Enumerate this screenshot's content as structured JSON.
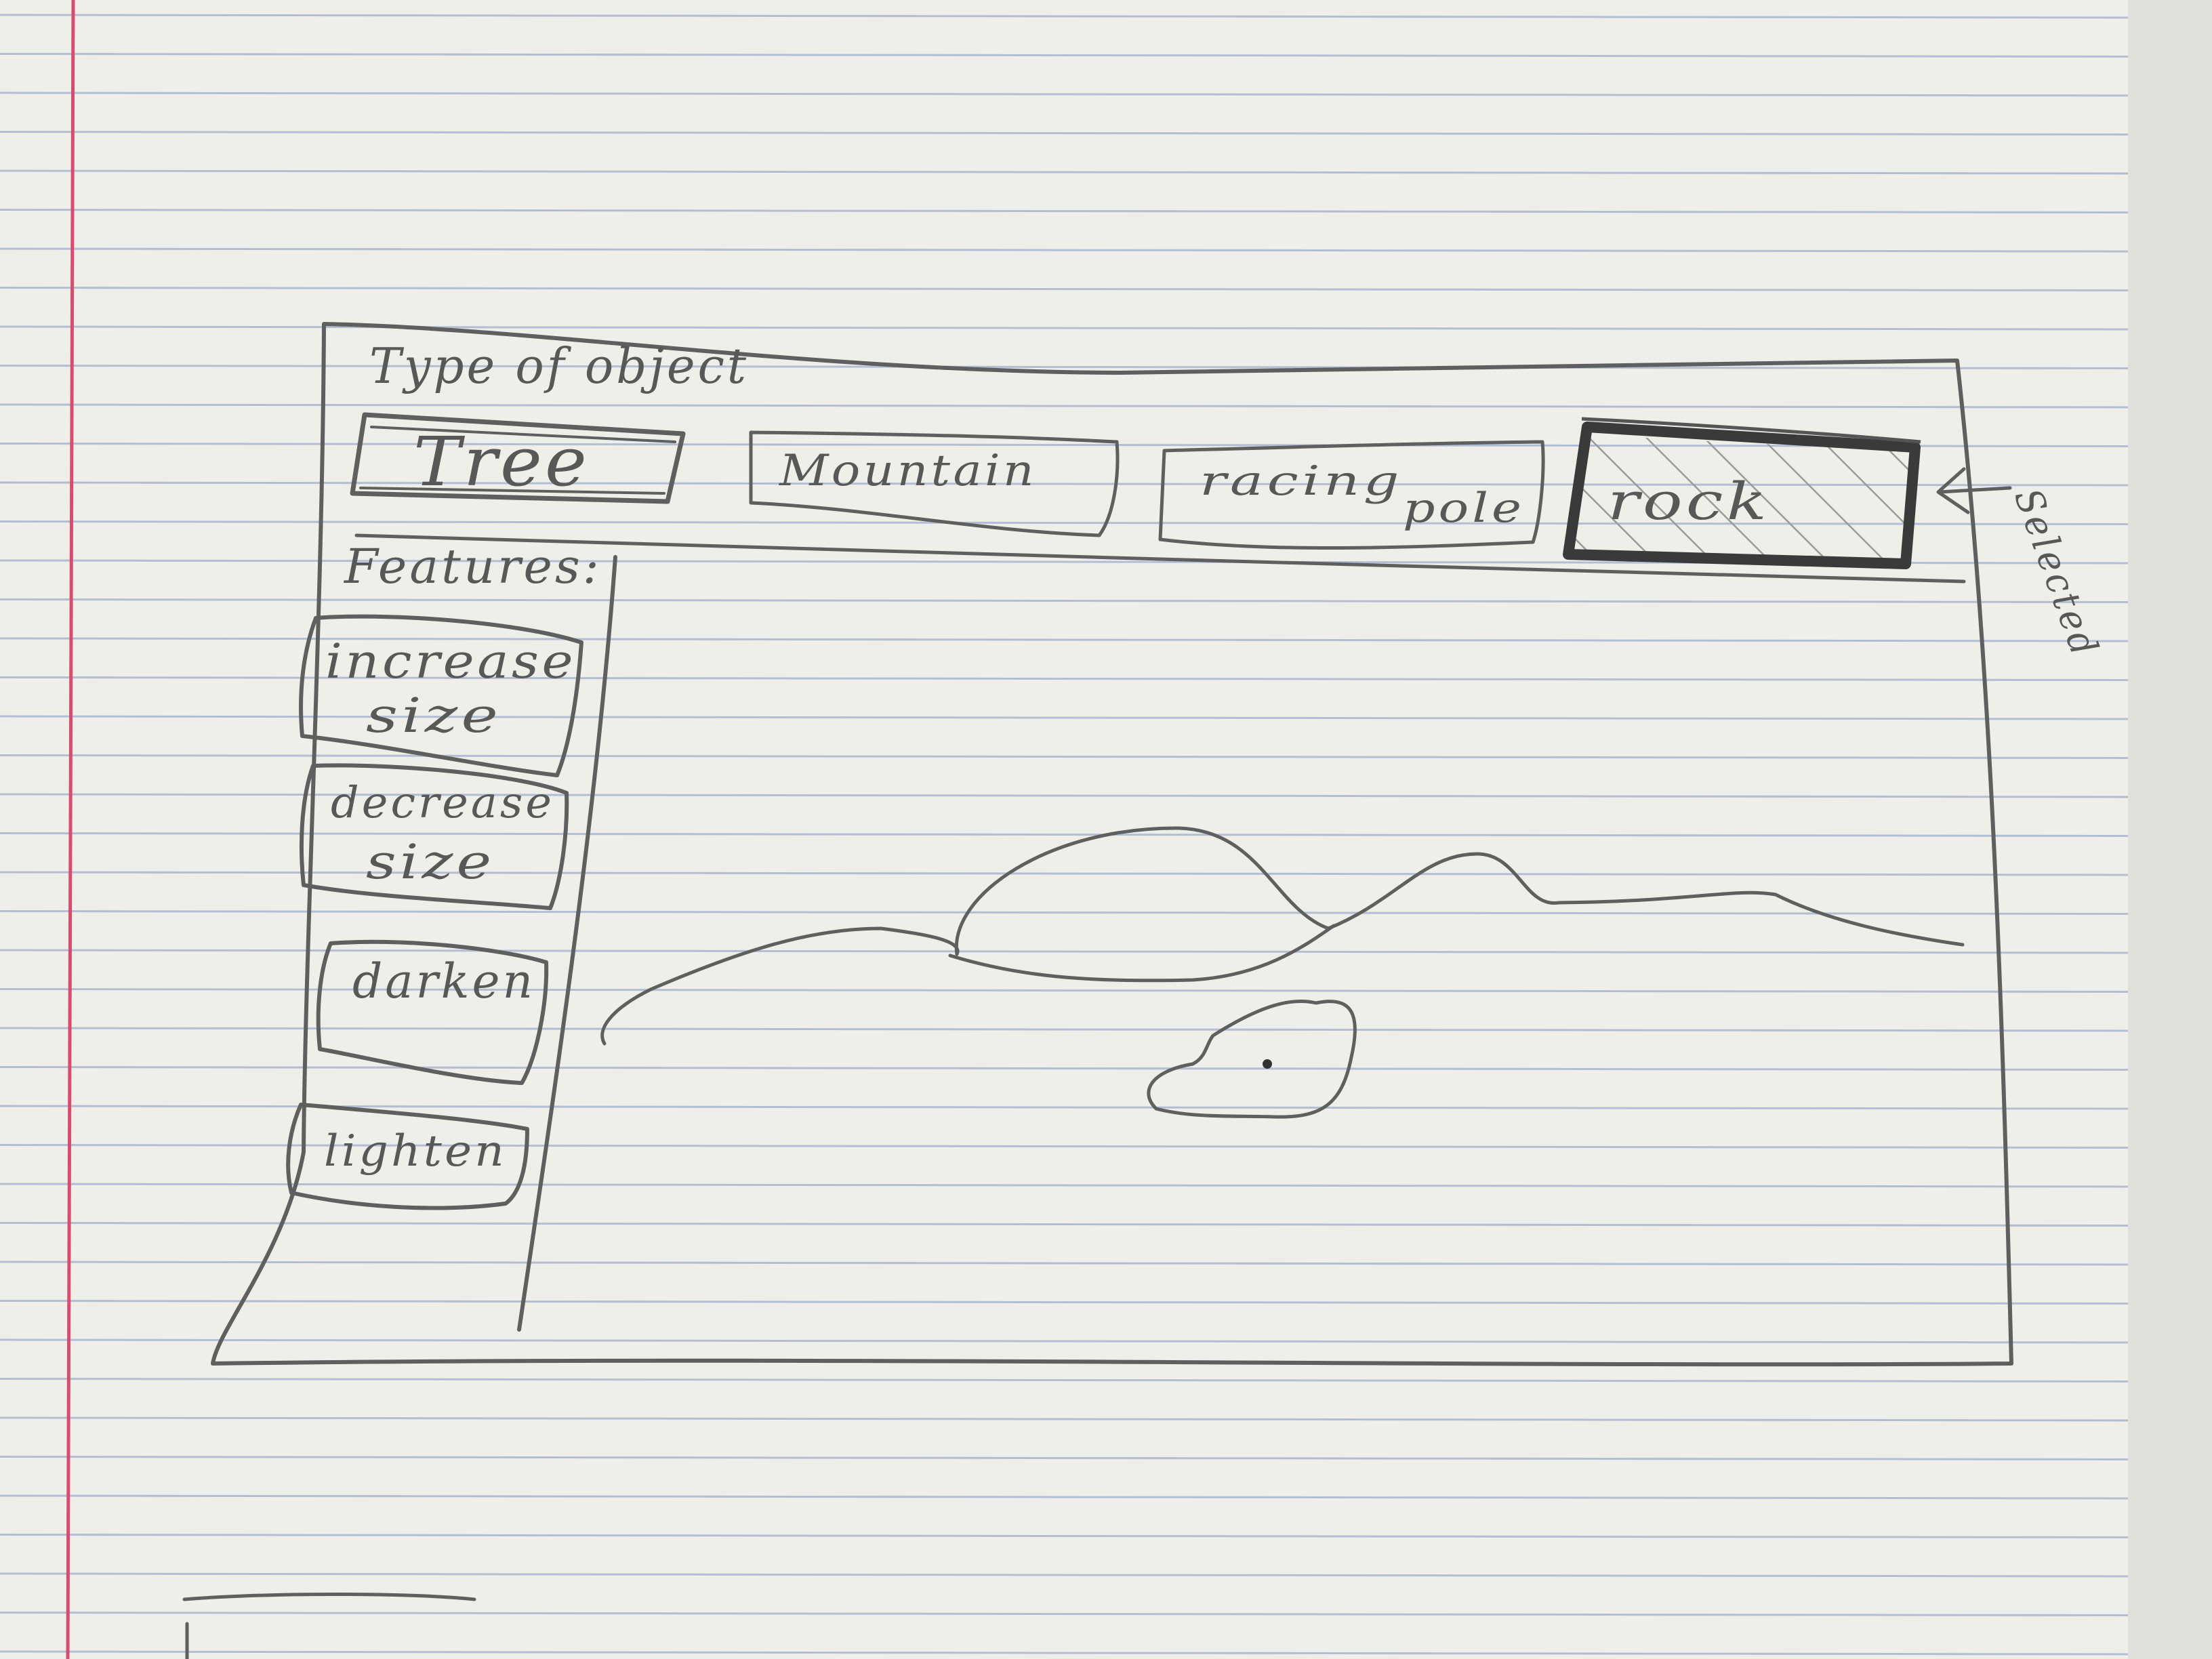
{
  "app": {
    "type_label": "Type of object",
    "features_label": "Features:"
  },
  "object_types": [
    {
      "label": "Tree"
    },
    {
      "label": "Mountain"
    },
    {
      "label_line1": "racing",
      "label_line2": "pole"
    },
    {
      "label": "rock"
    }
  ],
  "selected_object": "rock",
  "selected_annotation": "Selected",
  "features": [
    {
      "line1": "increase",
      "line2": "size"
    },
    {
      "line1": "decrease",
      "line2": "size"
    },
    {
      "line1": "darken"
    },
    {
      "line1": "lighten"
    }
  ],
  "colors": {
    "paper": "#efeee9",
    "rule_line": "#7f98c2",
    "margin_line": "#d94c6f",
    "pencil": "#5f5f5f",
    "pencil_dark": "#3a3a3a",
    "shade": "#999999"
  }
}
